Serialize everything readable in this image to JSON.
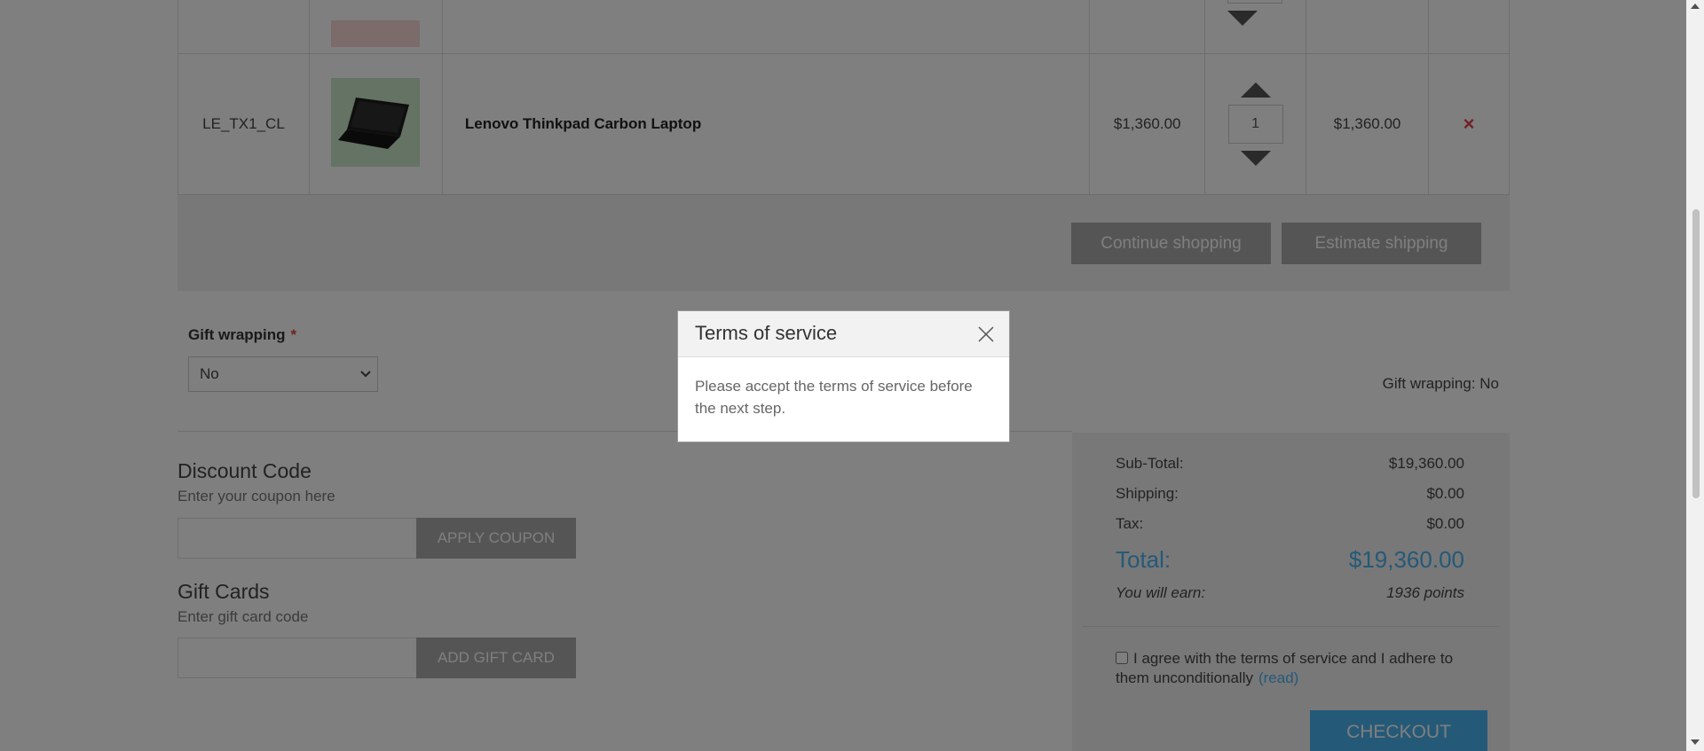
{
  "cart": {
    "rows": [
      {
        "sku": "",
        "name": "",
        "price": "",
        "qty": "",
        "total": ""
      },
      {
        "sku": "LE_TX1_CL",
        "name": "Lenovo Thinkpad Carbon Laptop",
        "price": "$1,360.00",
        "qty": "1",
        "total": "$1,360.00",
        "remove_icon": "×"
      }
    ],
    "continue_label": "Continue shopping",
    "estimate_label": "Estimate shipping"
  },
  "gift_wrapping": {
    "label": "Gift wrapping",
    "required_mark": "*",
    "selected": "No",
    "summary": "Gift wrapping: No"
  },
  "discount": {
    "title": "Discount Code",
    "subtitle": "Enter your coupon here",
    "button": "APPLY COUPON"
  },
  "gift_cards": {
    "title": "Gift Cards",
    "subtitle": "Enter gift card code",
    "button": "ADD GIFT CARD"
  },
  "totals": {
    "subtotal_label": "Sub-Total:",
    "subtotal_value": "$19,360.00",
    "shipping_label": "Shipping:",
    "shipping_value": "$0.00",
    "tax_label": "Tax:",
    "tax_value": "$0.00",
    "total_label": "Total:",
    "total_value": "$19,360.00",
    "earn_label": "You will earn:",
    "earn_value": "1936 points",
    "tos_text": "I agree with the terms of service and I adhere to them unconditionally",
    "tos_link": "(read)",
    "checkout_label": "CHECKOUT"
  },
  "modal": {
    "title": "Terms of service",
    "body": "Please accept the terms of service before the next step."
  },
  "colors": {
    "accent": "#4ab2f1",
    "remove": "#e4434b",
    "overlay": "rgba(0,0,0,0.5)"
  }
}
